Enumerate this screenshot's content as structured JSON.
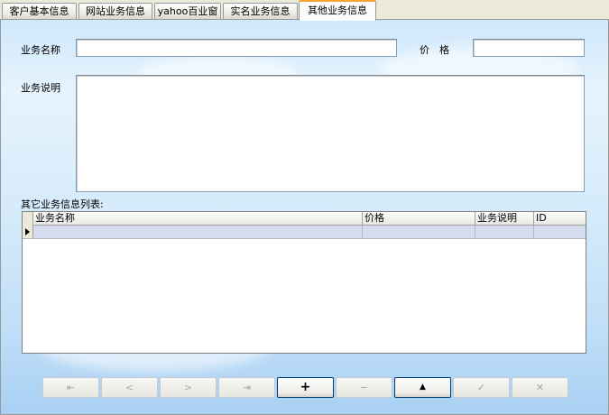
{
  "tabs": [
    {
      "label": "客户基本信息",
      "active": false
    },
    {
      "label": "网站业务信息",
      "active": false
    },
    {
      "label": "yahoo百业窗",
      "active": false
    },
    {
      "label": "实名业务信息",
      "active": false
    },
    {
      "label": "其他业务信息",
      "active": true
    }
  ],
  "form": {
    "name_label": "业务名称",
    "name_value": "",
    "price_label": "价　格",
    "price_value": "",
    "desc_label": "业务说明",
    "desc_value": "",
    "list_label": "其它业务信息列表:"
  },
  "grid": {
    "columns": [
      "业务名称",
      "价格",
      "业务说明",
      "ID"
    ],
    "rows": [
      [
        "",
        "",
        "",
        ""
      ]
    ]
  },
  "navigator": [
    {
      "name": "first",
      "glyph": "⇤",
      "enabled": false
    },
    {
      "name": "prior",
      "glyph": "<",
      "enabled": false
    },
    {
      "name": "next",
      "glyph": ">",
      "enabled": false
    },
    {
      "name": "last",
      "glyph": "⇥",
      "enabled": false
    },
    {
      "name": "insert",
      "glyph": "+",
      "enabled": true
    },
    {
      "name": "delete",
      "glyph": "−",
      "enabled": false
    },
    {
      "name": "edit",
      "glyph": "▲",
      "enabled": true
    },
    {
      "name": "post",
      "glyph": "✓",
      "enabled": false
    },
    {
      "name": "cancel",
      "glyph": "✕",
      "enabled": false
    }
  ]
}
